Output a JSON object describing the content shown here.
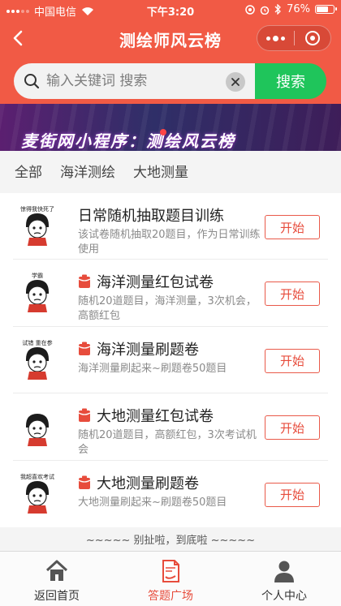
{
  "status_bar": {
    "carrier": "中国电信",
    "time": "下午3:20",
    "battery": "76%",
    "battery_level": 0.76
  },
  "nav": {
    "title": "测绘师风云榜"
  },
  "search": {
    "placeholder": "输入关键词 搜索",
    "button_label": "搜索"
  },
  "banner": {
    "text": "麦街网小程序：测绘风云榜"
  },
  "tabs": [
    {
      "label": "全部"
    },
    {
      "label": "海洋测绘"
    },
    {
      "label": "大地测量"
    }
  ],
  "exams": [
    {
      "title": "日常随机抽取题目训练",
      "desc": "该试卷随机抽取20题目，作为日常训练使用",
      "has_bag": false,
      "button": "开始",
      "avatar_caption": "惊得我快死了"
    },
    {
      "title": "海洋测量红包试卷",
      "desc": "随机20道题目，海洋测量，3次机会，高额红包",
      "has_bag": true,
      "button": "开始",
      "avatar_caption": "学霸"
    },
    {
      "title": "海洋测量刷题卷",
      "desc": "海洋测量刷起来~刷题卷50题目",
      "has_bag": true,
      "button": "开始",
      "avatar_caption": "试错 重在参"
    },
    {
      "title": "大地测量红包试卷",
      "desc": "随机20道题目，高额红包，3次考试机会",
      "has_bag": true,
      "button": "开始",
      "avatar_caption": ""
    },
    {
      "title": "大地测量刷题卷",
      "desc": "大地测量刷起来~刷题卷50题目",
      "has_bag": true,
      "button": "开始",
      "avatar_caption": "我超喜欢考试"
    }
  ],
  "end_tip": "~~~~~ 别扯啦，到底啦 ~~~~~",
  "tab_bar": [
    {
      "label": "返回首页",
      "icon": "home-icon",
      "active": false
    },
    {
      "label": "答题广场",
      "icon": "exam-paper-icon",
      "active": true
    },
    {
      "label": "个人中心",
      "icon": "user-icon",
      "active": false
    }
  ],
  "colors": {
    "brand": "#f15a45",
    "search_button": "#1fc55b",
    "accent": "#e74c3c"
  }
}
